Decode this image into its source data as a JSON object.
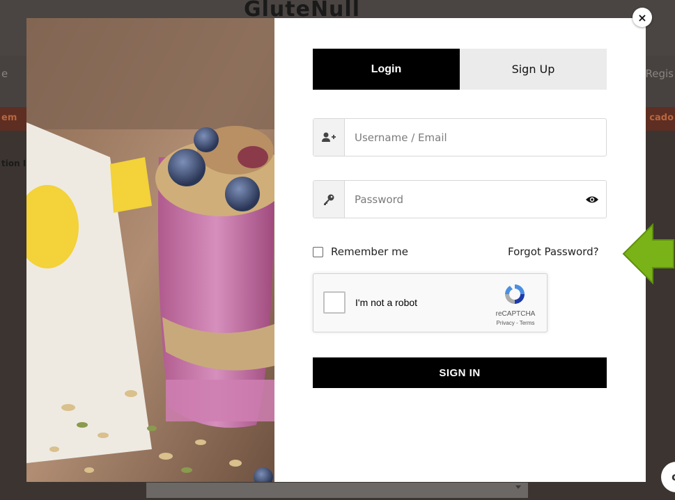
{
  "background": {
    "logo": "GluteNull",
    "nav_left": "e",
    "nav_right": "Regis",
    "band_left": "em",
    "band_right": "cado",
    "side_text": "tion I"
  },
  "modal": {
    "close_label": "×",
    "tabs": [
      {
        "label": "Login",
        "active": true
      },
      {
        "label": "Sign Up",
        "active": false
      }
    ],
    "username": {
      "placeholder": "Username / Email",
      "value": "",
      "icon": "user-plus-icon"
    },
    "password": {
      "placeholder": "Password",
      "value": "",
      "icon": "key-icon",
      "toggle_icon": "eye-icon"
    },
    "remember_label": "Remember me",
    "remember_checked": false,
    "forgot_label": "Forgot Password?",
    "recaptcha": {
      "label": "I'm not a robot",
      "brand": "reCAPTCHA",
      "links": "Privacy - Terms"
    },
    "signin_label": "SIGN IN"
  },
  "colors": {
    "primary": "#000000",
    "tab_inactive": "#ebebeb",
    "annotation_arrow": "#7ab317"
  },
  "annotation": {
    "icon": "arrow-left-icon",
    "points_to": "Forgot Password?"
  }
}
